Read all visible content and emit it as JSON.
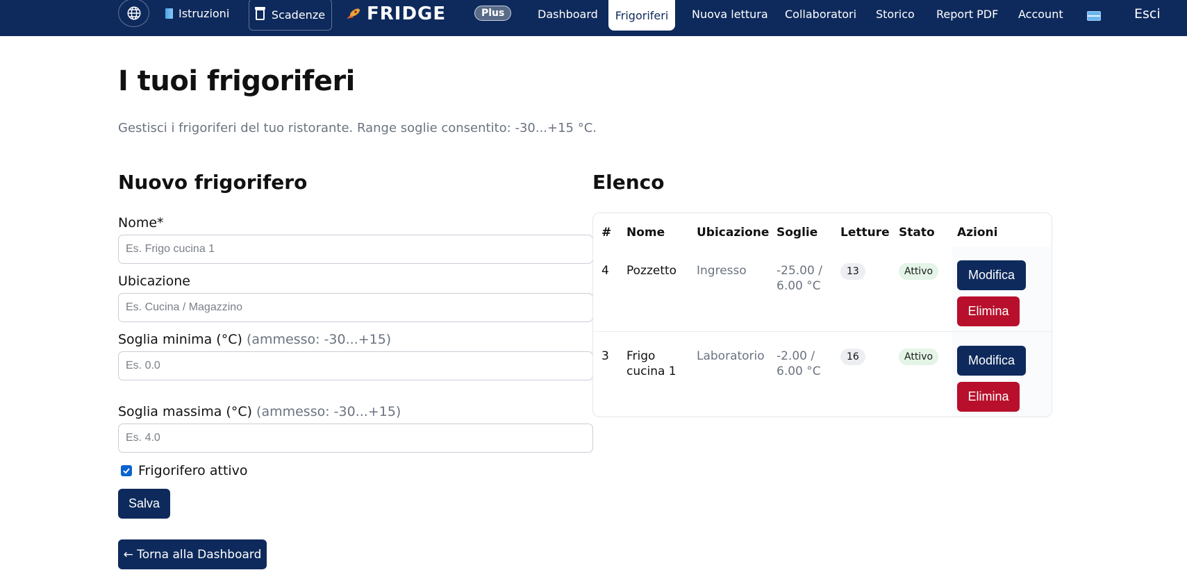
{
  "navbar": {
    "istruzioni": "Istruzioni",
    "scadenze": "Scadenze",
    "brand": "FRIDGE",
    "plan_badge": "Plus",
    "links": [
      "Dashboard",
      "Frigoriferi",
      "Nuova lettura",
      "Collaboratori",
      "Storico",
      "Report PDF",
      "Account"
    ],
    "active": "Frigoriferi",
    "logout": "Esci",
    "icons": [
      "globe-icon",
      "book-icon",
      "jar-icon",
      "rocket-icon",
      "credit-card-icon"
    ]
  },
  "page": {
    "title": "I tuoi frigoriferi",
    "subtitle": "Gestisci i frigoriferi del tuo ristorante. Range soglie consentito: -30...+15 °C."
  },
  "form": {
    "heading": "Nuovo frigorifero",
    "nome_label": "Nome*",
    "nome_placeholder": "Es. Frigo cucina 1",
    "ubicazione_label": "Ubicazione",
    "ubicazione_placeholder": "Es. Cucina / Magazzino",
    "min_label": "Soglia minima (°C)",
    "min_hint": "(ammesso: -30...+15)",
    "min_placeholder": "Es. 0.0",
    "max_label": "Soglia massima (°C)",
    "max_hint": "(ammesso: -30...+15)",
    "max_placeholder": "Es. 4.0",
    "active_label": "Frigorifero attivo",
    "active_checked": true,
    "save_label": "Salva",
    "back_label": "← Torna alla Dashboard"
  },
  "list": {
    "heading": "Elenco",
    "columns": [
      "#",
      "Nome",
      "Ubicazione",
      "Soglie",
      "Letture",
      "Stato",
      "Azioni"
    ],
    "rows": [
      {
        "id": "4",
        "nome": [
          "Pozzetto"
        ],
        "ubicazione": "Ingresso",
        "soglie": [
          "-25.00 /",
          "6.00 °C"
        ],
        "letture": "13",
        "stato": "Attivo"
      },
      {
        "id": "3",
        "nome": [
          "Frigo",
          "cucina 1"
        ],
        "ubicazione": "Laboratorio",
        "soglie": [
          "-2.00 /",
          "6.00 °C"
        ],
        "letture": "16",
        "stato": "Attivo"
      }
    ],
    "edit_label": "Modifica",
    "delete_label": "Elimina"
  },
  "colors": {
    "navbar": "#0e2a5c",
    "primary_button": "#0e2a5c",
    "danger_button": "#b8102c",
    "status_badge": "#e4f4e7"
  }
}
